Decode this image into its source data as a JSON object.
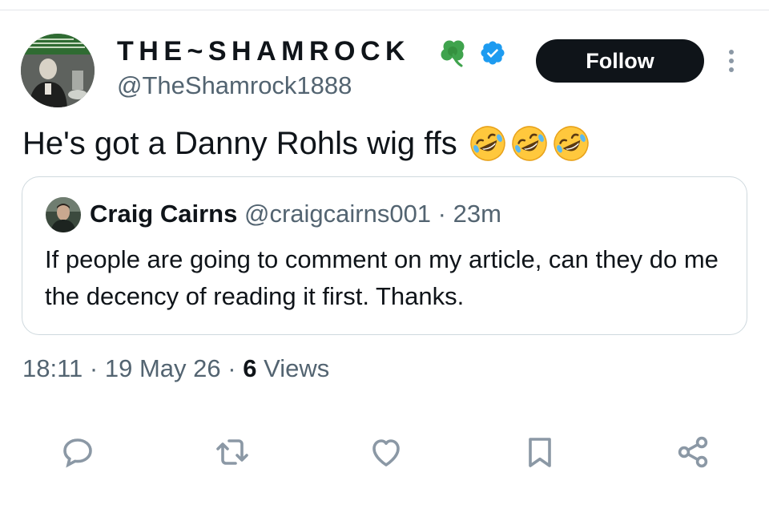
{
  "author": {
    "display_name": "THE~SHAMROCK",
    "handle": "@TheShamrock1888",
    "verified": true,
    "name_emoji": "shamrock"
  },
  "follow_button": {
    "label": "Follow"
  },
  "tweet": {
    "text": "He's got a Danny Rohls wig ffs",
    "emojis": [
      "rolling-on-floor-laughing",
      "rolling-on-floor-laughing",
      "rolling-on-floor-laughing"
    ]
  },
  "quote": {
    "name": "Craig Cairns",
    "handle": "@craigcairns001",
    "separator": "·",
    "time": "23m",
    "text": "If people are going to comment on my article, can they do me the decency of reading it first. Thanks."
  },
  "meta": {
    "time": "18:11",
    "separator": "·",
    "date": "19 May 26",
    "views_count": "6",
    "views_label": "Views"
  },
  "actions": [
    "reply-icon",
    "retweet-icon",
    "like-icon",
    "bookmark-icon",
    "share-icon"
  ],
  "colors": {
    "text_primary": "#0f1419",
    "text_secondary": "#536471",
    "verified_blue": "#1d9bf0",
    "shamrock_green": "#3fa34d",
    "icon_gray": "#8b98a5",
    "border": "#cfd9de"
  }
}
